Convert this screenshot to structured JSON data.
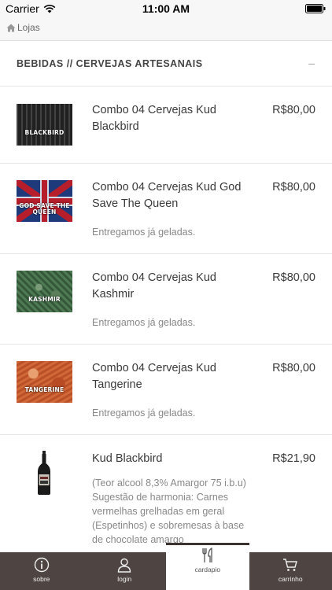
{
  "status_bar": {
    "carrier": "Carrier",
    "time": "11:00 AM"
  },
  "nav": {
    "breadcrumb": "Lojas"
  },
  "section": {
    "title": "BEBIDAS // CERVEJAS ARTESANAIS",
    "toggle": "–"
  },
  "products": [
    {
      "name": "Combo 04 Cervejas Kud Blackbird",
      "price": "R$80,00",
      "description": "",
      "thumb_label": "BLACKBIRD"
    },
    {
      "name": "Combo 04 Cervejas Kud God Save The Queen",
      "price": "R$80,00",
      "description": "Entregamos já geladas.",
      "thumb_label": "GOD SAVE THE QUEEN"
    },
    {
      "name": "Combo 04 Cervejas Kud Kashmir",
      "price": "R$80,00",
      "description": "Entregamos já geladas.",
      "thumb_label": "KASHMIR"
    },
    {
      "name": "Combo 04 Cervejas Kud Tangerine",
      "price": "R$80,00",
      "description": "Entregamos já geladas.",
      "thumb_label": "TANGERINE"
    },
    {
      "name": "Kud Blackbird",
      "price": "R$21,90",
      "description": "(Teor alcool 8,3% Amargor 75 i.b.u) Sugestão de harmonia: Carnes vermelhas grelhadas em geral (Espetinhos) e sobremesas à base de chocolate amargo"
    }
  ],
  "tabs": [
    {
      "label": "sobre",
      "icon": "info-icon",
      "active": false
    },
    {
      "label": "login",
      "icon": "user-icon",
      "active": false
    },
    {
      "label": "cardapio",
      "icon": "cutlery-icon",
      "active": true
    },
    {
      "label": "carrinho",
      "icon": "cart-icon",
      "active": false
    }
  ],
  "colors": {
    "tab_bar": "#4e4542",
    "text": "#3a3a3a",
    "muted": "#888888"
  }
}
